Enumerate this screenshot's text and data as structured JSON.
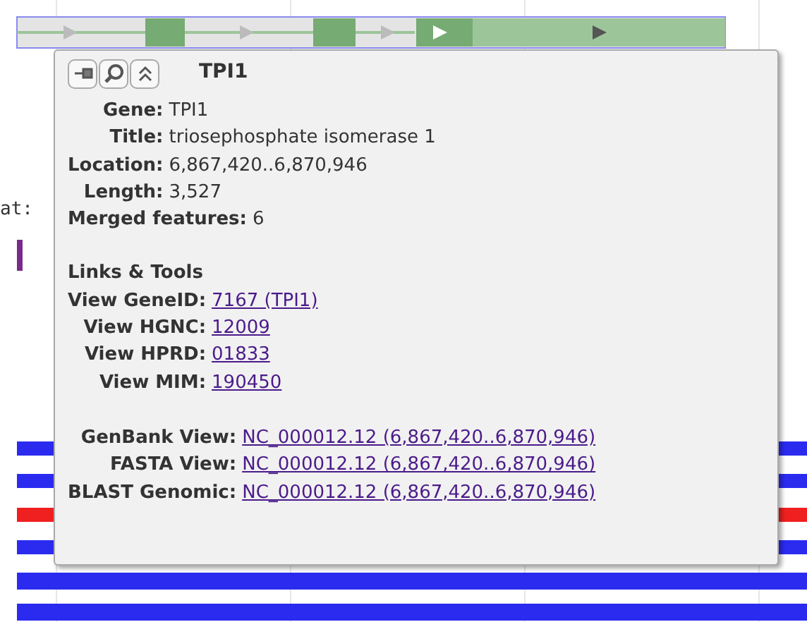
{
  "background": {
    "label_fragment": "at:"
  },
  "popup": {
    "title": "TPI1",
    "fields": [
      {
        "label": "Gene:",
        "value": "TPI1"
      },
      {
        "label": "Title:",
        "value": "triosephosphate isomerase 1"
      },
      {
        "label": "Location:",
        "value": "6,867,420..6,870,946"
      },
      {
        "label": "Length:",
        "value": "3,527"
      }
    ],
    "merged": {
      "label": "Merged features:",
      "value": "6"
    },
    "section_title": "Links & Tools",
    "links": [
      {
        "label": "View GeneID:",
        "value": "7167 (TPI1)"
      },
      {
        "label": "View HGNC:",
        "value": "12009"
      },
      {
        "label": "View HPRD:",
        "value": "01833"
      },
      {
        "label": "View MIM:",
        "value": "190450"
      }
    ],
    "sequence_links": [
      {
        "label": "GenBank View:",
        "value": "NC_000012.12 (6,867,420..6,870,946)"
      },
      {
        "label": "FASTA View:",
        "value": "NC_000012.12 (6,867,420..6,870,946)"
      },
      {
        "label": "BLAST Genomic:",
        "value": "NC_000012.12 (6,867,420..6,870,946)"
      }
    ]
  }
}
